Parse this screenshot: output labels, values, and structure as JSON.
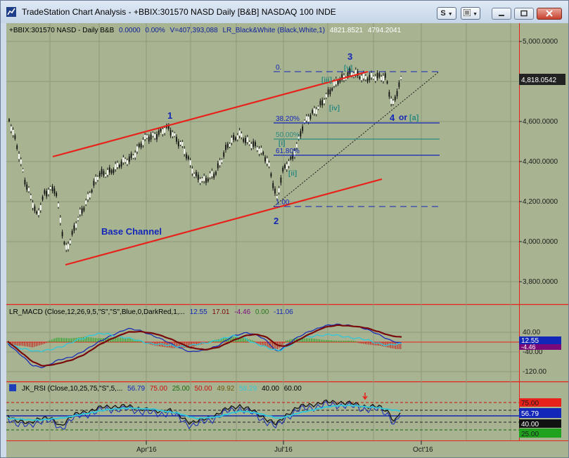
{
  "window": {
    "title": "TradeStation Chart Analysis - +BBIX:301570 NASD Daily [B&B] NASDAQ 100 INDE",
    "button_s": "S"
  },
  "colors": {
    "chart_bg": "#a8b391",
    "red": "#e8211b",
    "blue": "#1226b8",
    "teal": "#2c8a80",
    "darkred": "#7a0a0a"
  },
  "price_pane": {
    "header": {
      "symbol": "+BBIX:301570 NASD - Daily  B&B",
      "v1": "0.0000",
      "v2": "0.00%",
      "volume": "V=407,393,088",
      "study": "LR_Black&White (Black,White,1)",
      "p1": "4821.8521",
      "p2": "4794.2041"
    },
    "y_axis_labels": [
      "5,000.0000",
      "4,800.0000",
      "4,600.0000",
      "4,400.0000",
      "4,200.0000",
      "4,000.0000",
      "3,800.0000"
    ],
    "last_price": "4,818.0542",
    "wave_labels": {
      "w1": "1",
      "w2": "2",
      "w3": "3",
      "w4": "4",
      "w4_or": "or",
      "w4_alt": "[a]",
      "sub_i": "[i]",
      "sub_ii": "[ii]",
      "sub_iii": "[iii]",
      "sub_iv": "[iv]",
      "sub_v": "[v]"
    },
    "fib_labels": {
      "zero": "0.",
      "f382": "38.20%",
      "f500": "50.00%",
      "f618": "61.80%",
      "one": "1.00"
    },
    "channel_label": "Base Channel"
  },
  "macd_pane": {
    "header": {
      "study": "LR_MACD (Close,12,26,9,5,\"S\",\"S\",Blue,0,DarkRed,1,...",
      "a": "12.55",
      "b": "17.01",
      "c": "-4.46",
      "d": "0.00",
      "e": "-11.06"
    },
    "y_axis_labels": [
      "40.00",
      "-40.00",
      "-120.00"
    ],
    "badge_value": "12.55",
    "badge_under": "-4.46"
  },
  "rsi_pane": {
    "header": {
      "study": "JK_RSI (Close,10,25,75,\"S\",5,...",
      "a": "56.79",
      "b": "75.00",
      "c": "25.00",
      "d": "50.00",
      "e": "49.92",
      "f": "58.29",
      "g": "40.00",
      "h": "60.00"
    },
    "badges": {
      "b75": "75.00",
      "b5679": "56.79",
      "b40": "40.00",
      "b25": "25.00"
    }
  },
  "x_axis_labels": [
    "Apr'16",
    "Jul'16",
    "Oct'16"
  ]
}
